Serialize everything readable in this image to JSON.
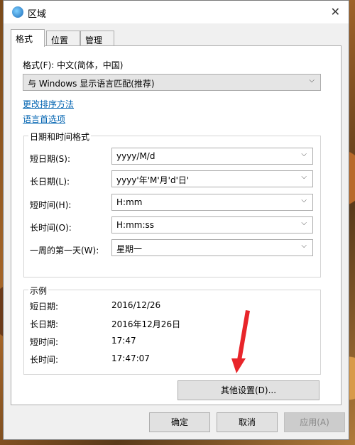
{
  "window": {
    "title": "区域",
    "close_glyph": "✕"
  },
  "tabs": [
    {
      "label": "格式",
      "active": true
    },
    {
      "label": "位置",
      "active": false
    },
    {
      "label": "管理",
      "active": false
    }
  ],
  "format": {
    "label": "格式(F): 中文(简体，中国)",
    "selected": "与 Windows 显示语言匹配(推荐)"
  },
  "links": {
    "sort": "更改排序方法",
    "language": "语言首选项"
  },
  "datetime_group": {
    "title": "日期和时间格式",
    "rows": [
      {
        "label": "短日期(S):",
        "value": "yyyy/M/d"
      },
      {
        "label": "长日期(L):",
        "value": "yyyy'年'M'月'd'日'"
      },
      {
        "label": "短时间(H):",
        "value": "H:mm"
      },
      {
        "label": "长时间(O):",
        "value": "H:mm:ss"
      },
      {
        "label": "一周的第一天(W):",
        "value": "星期一"
      }
    ]
  },
  "example_group": {
    "title": "示例",
    "rows": [
      {
        "label": "短日期:",
        "value": "2016/12/26"
      },
      {
        "label": "长日期:",
        "value": "2016年12月26日"
      },
      {
        "label": "短时间:",
        "value": "17:47"
      },
      {
        "label": "长时间:",
        "value": "17:47:07"
      }
    ]
  },
  "buttons": {
    "additional": "其他设置(D)...",
    "ok": "确定",
    "cancel": "取消",
    "apply": "应用(A)"
  },
  "dropdown_glyph": "⌵",
  "colors": {
    "link": "#0063b1",
    "annotation_arrow": "#e8252a"
  }
}
